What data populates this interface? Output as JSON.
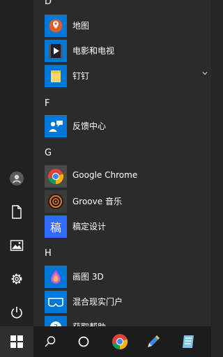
{
  "start_menu": {
    "groups": [
      {
        "letter": "D",
        "apps": [
          {
            "label": "地图",
            "icon": "maps-icon",
            "tile_color": "#0078d7"
          },
          {
            "label": "电影和电视",
            "icon": "movies-tv-icon",
            "tile_color": "#0078d7"
          },
          {
            "label": "钉钉",
            "icon": "folder-icon",
            "tile_color": "#0078d7",
            "expandable": true,
            "expand_icon": "chevron-down-icon"
          }
        ]
      },
      {
        "letter": "F",
        "apps": [
          {
            "label": "反馈中心",
            "icon": "feedback-hub-icon",
            "tile_color": "#0078d7"
          }
        ]
      },
      {
        "letter": "G",
        "apps": [
          {
            "label": "Google Chrome",
            "icon": "chrome-icon",
            "tile_color": "#4a4a4a"
          },
          {
            "label": "Groove 音乐",
            "icon": "groove-music-icon",
            "tile_color": "#3a3a3a"
          },
          {
            "label": "稿定设计",
            "icon": "gaoding-design-icon",
            "tile_color": "#2f6bff",
            "tile_text": "稿"
          }
        ]
      },
      {
        "letter": "H",
        "apps": [
          {
            "label": "画图 3D",
            "icon": "paint-3d-icon",
            "tile_color": "#0078d7"
          },
          {
            "label": "混合现实门户",
            "icon": "mixed-reality-portal-icon",
            "tile_color": "#0078d7"
          },
          {
            "label": "获取帮助",
            "icon": "get-help-icon",
            "tile_color": "#0078d7"
          }
        ]
      }
    ],
    "rail": [
      "user-avatar-icon",
      "documents-icon",
      "pictures-icon",
      "settings-gear-icon",
      "power-icon"
    ]
  },
  "taskbar": {
    "items": [
      "windows-start-icon",
      "search-icon",
      "task-view-icon",
      "chrome-icon",
      "pencil-app-icon",
      "notes-app-icon"
    ]
  }
}
